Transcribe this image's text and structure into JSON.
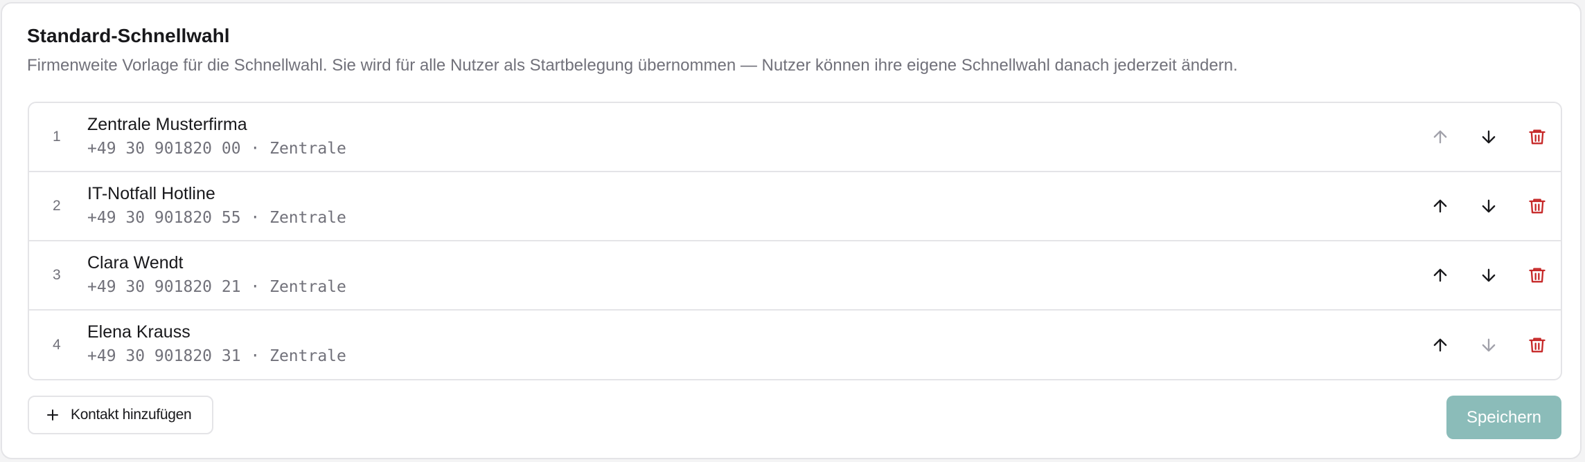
{
  "section": {
    "title": "Standard-Schnellwahl",
    "description": "Firmenweite Vorlage für die Schnellwahl. Sie wird für alle Nutzer als Startbelegung übernommen — Nutzer können ihre eigene Schnellwahl danach jederzeit ändern."
  },
  "entries": [
    {
      "index": "1",
      "name": "Zentrale Musterfirma",
      "detail": "+49 30 901820 00 · Zentrale",
      "up_enabled": false,
      "down_enabled": true
    },
    {
      "index": "2",
      "name": "IT-Notfall Hotline",
      "detail": "+49 30 901820 55 · Zentrale",
      "up_enabled": true,
      "down_enabled": true
    },
    {
      "index": "3",
      "name": "Clara Wendt",
      "detail": "+49 30 901820 21 · Zentrale",
      "up_enabled": true,
      "down_enabled": true
    },
    {
      "index": "4",
      "name": "Elena Krauss",
      "detail": "+49 30 901820 31 · Zentrale",
      "up_enabled": true,
      "down_enabled": false
    }
  ],
  "actions": {
    "add_label": "Kontakt hinzufügen",
    "add_icon": "plus-icon",
    "save_label": "Speichern",
    "save_enabled": false
  },
  "icons": {
    "move_up": "arrow-up-icon",
    "move_down": "arrow-down-icon",
    "delete": "trash-icon"
  },
  "colors": {
    "delete": "#c62828",
    "enabled_arrow": "#18181b",
    "disabled_arrow": "#a1a1aa",
    "save_disabled_bg": "#8bbcb9"
  }
}
